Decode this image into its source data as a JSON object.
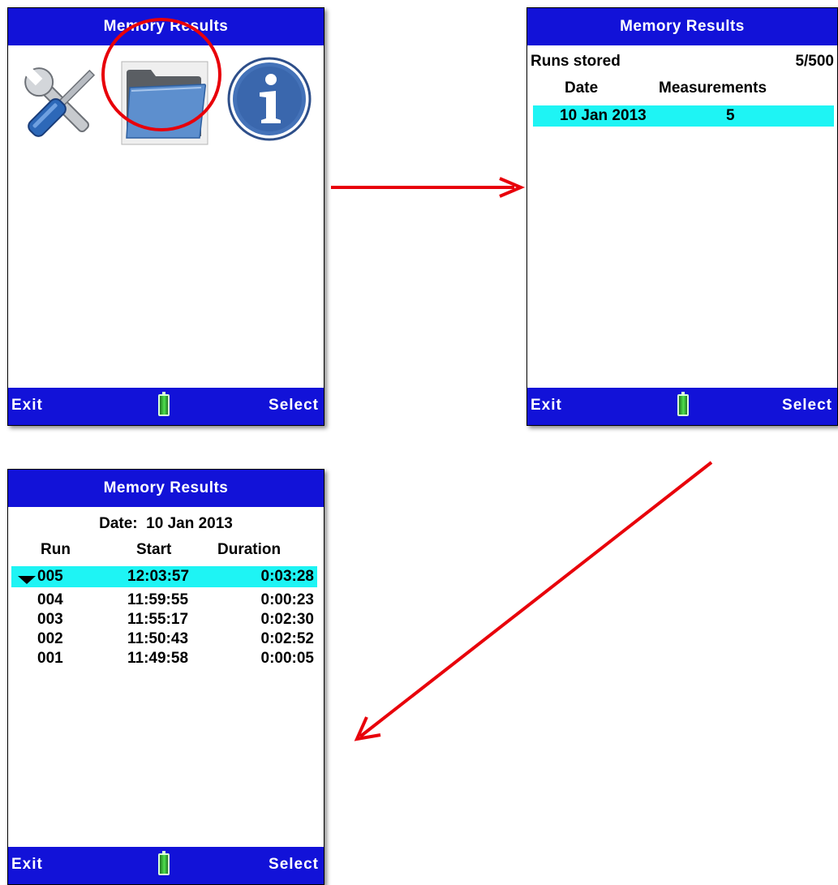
{
  "screens": {
    "menu": {
      "title": "Memory Results",
      "icons": [
        "tools-icon",
        "folder-icon",
        "info-icon"
      ],
      "footer": {
        "left": "Exit",
        "right": "Select"
      }
    },
    "runs_overview": {
      "title": "Memory Results",
      "runs_stored_label": "Runs stored",
      "runs_stored_value": "5/500",
      "col_date": "Date",
      "col_measurements": "Measurements",
      "rows": [
        {
          "date": "10 Jan 2013",
          "measurements": "5"
        }
      ],
      "footer": {
        "left": "Exit",
        "right": "Select"
      }
    },
    "run_list": {
      "title": "Memory Results",
      "date_line": "Date:  10 Jan 2013",
      "col_run": "Run",
      "col_start": "Start",
      "col_duration": "Duration",
      "rows": [
        {
          "run": "005",
          "start": "12:03:57",
          "duration": "0:03:28"
        },
        {
          "run": "004",
          "start": "11:59:55",
          "duration": "0:00:23"
        },
        {
          "run": "003",
          "start": "11:55:17",
          "duration": "0:02:30"
        },
        {
          "run": "002",
          "start": "11:50:43",
          "duration": "0:02:52"
        },
        {
          "run": "001",
          "start": "11:49:58",
          "duration": "0:00:05"
        }
      ],
      "footer": {
        "left": "Exit",
        "right": "Select"
      }
    }
  },
  "colors": {
    "bar_blue": "#1212d8",
    "highlight_cyan": "#1ef4f4",
    "arrow_red": "#e8000a",
    "battery_green": "#3ccf3c"
  }
}
